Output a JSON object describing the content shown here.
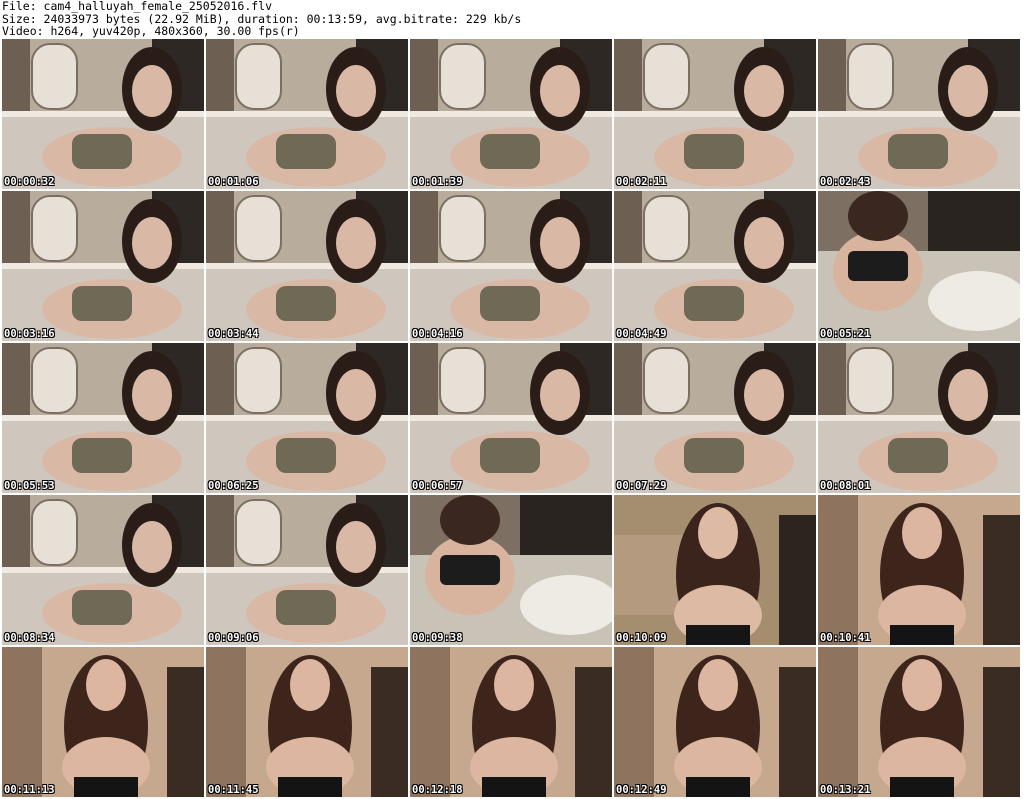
{
  "header": {
    "line1": "File: cam4_halluyah_female_25052016.flv",
    "line2": "Size: 24033973 bytes (22.92 MiB), duration: 00:13:59, avg.bitrate: 229 kb/s",
    "line3": "Video: h264, yuv420p, 480x360, 30.00 fps(r)"
  },
  "thumbnails": [
    {
      "timestamp": "00:00:32",
      "scene": "room"
    },
    {
      "timestamp": "00:01:06",
      "scene": "room"
    },
    {
      "timestamp": "00:01:39",
      "scene": "room"
    },
    {
      "timestamp": "00:02:11",
      "scene": "room"
    },
    {
      "timestamp": "00:02:43",
      "scene": "room"
    },
    {
      "timestamp": "00:03:16",
      "scene": "room"
    },
    {
      "timestamp": "00:03:44",
      "scene": "room"
    },
    {
      "timestamp": "00:04:16",
      "scene": "room"
    },
    {
      "timestamp": "00:04:49",
      "scene": "room"
    },
    {
      "timestamp": "00:05:21",
      "scene": "bed"
    },
    {
      "timestamp": "00:05:53",
      "scene": "room"
    },
    {
      "timestamp": "00:06:25",
      "scene": "room"
    },
    {
      "timestamp": "00:06:57",
      "scene": "room"
    },
    {
      "timestamp": "00:07:29",
      "scene": "room"
    },
    {
      "timestamp": "00:08:01",
      "scene": "room"
    },
    {
      "timestamp": "00:08:34",
      "scene": "room"
    },
    {
      "timestamp": "00:09:06",
      "scene": "room"
    },
    {
      "timestamp": "00:09:38",
      "scene": "bed"
    },
    {
      "timestamp": "00:10:09",
      "scene": "portrait-brick"
    },
    {
      "timestamp": "00:10:41",
      "scene": "portrait-warm"
    },
    {
      "timestamp": "00:11:13",
      "scene": "portrait-warm"
    },
    {
      "timestamp": "00:11:45",
      "scene": "portrait-warm"
    },
    {
      "timestamp": "00:12:18",
      "scene": "portrait-warm"
    },
    {
      "timestamp": "00:12:49",
      "scene": "portrait-warm"
    },
    {
      "timestamp": "00:13:21",
      "scene": "portrait-warm"
    }
  ]
}
